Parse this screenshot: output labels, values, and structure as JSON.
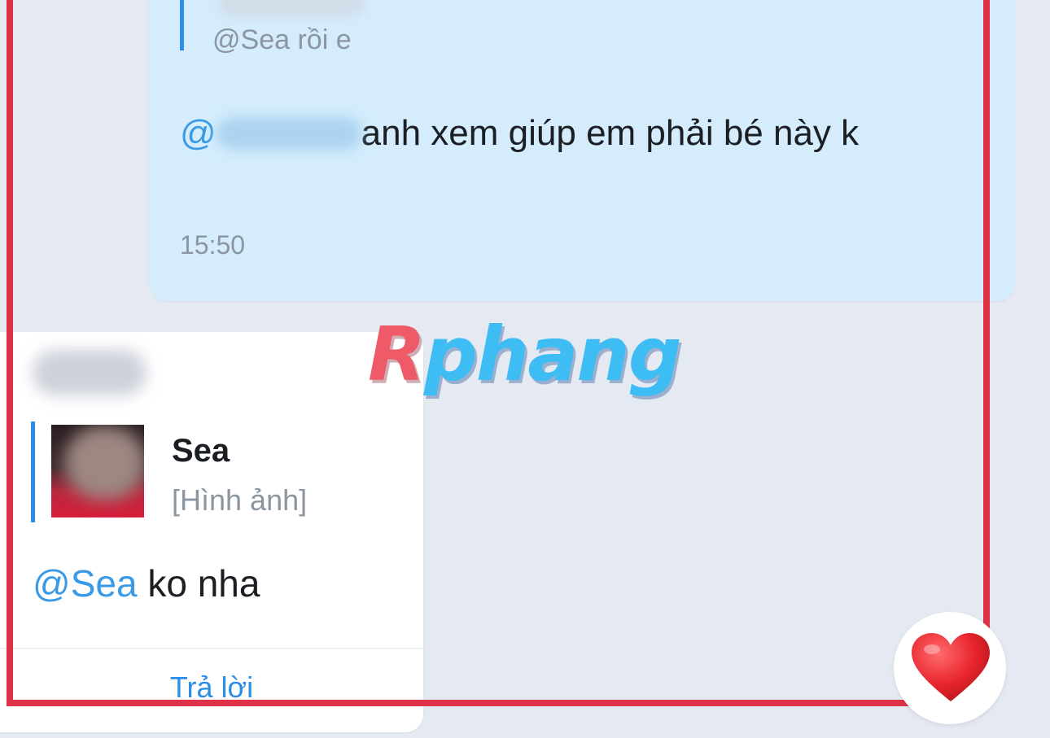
{
  "outgoing_message": {
    "quote_text": "@Sea rồi e",
    "mention_prefix": "@",
    "message_text": "anh xem giúp em phải bé này k",
    "time": "15:50"
  },
  "incoming_message": {
    "quote_sender": "Sea",
    "quote_content": "[Hình ảnh]",
    "mention": "@Sea",
    "message_text": " ko nha",
    "reply_label": "Trả lời"
  },
  "watermark": {
    "part1": "R",
    "part2": "phang"
  },
  "reaction_icon": "heart-icon",
  "colors": {
    "accent": "#2a8ee8",
    "mention": "#3a9ae6",
    "outgoing_bubble": "#d4ecfc",
    "highlight_frame": "#de3347",
    "heart": "#e8262d"
  }
}
